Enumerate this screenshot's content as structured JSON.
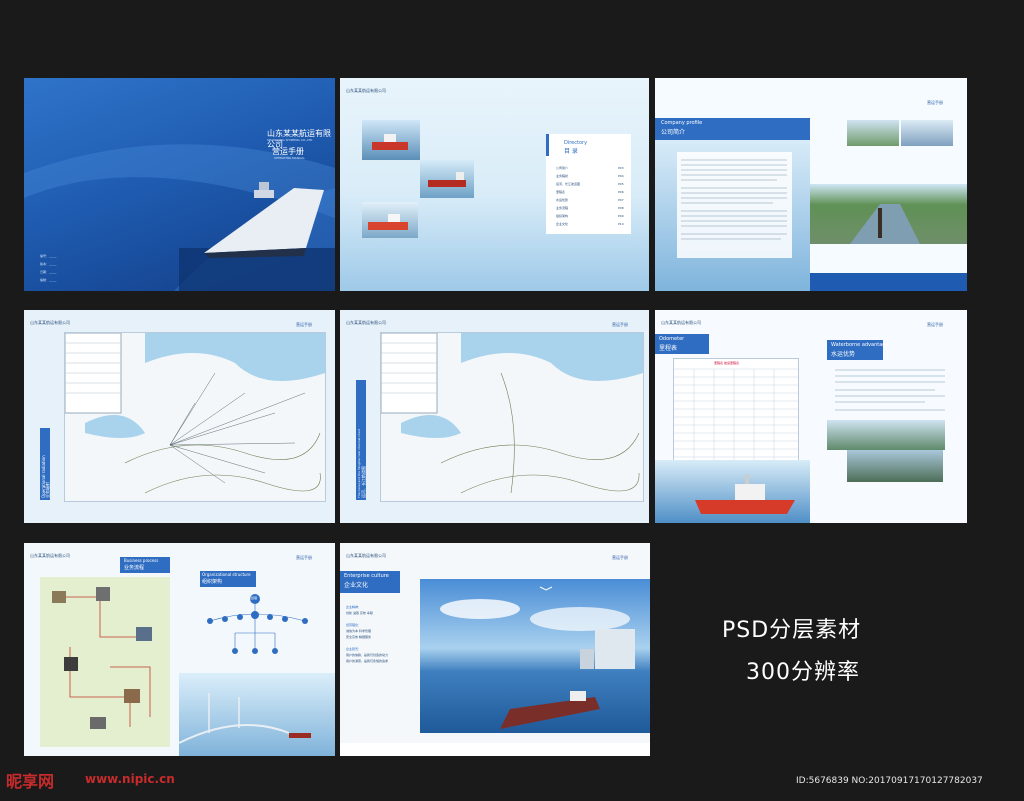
{
  "cover": {
    "company": "山东某某航运有限公司",
    "company_en": "SHANDONG SHIPPING CO.,LTD",
    "manual": "营运手册",
    "manual_en": "OPERATING MANUAL",
    "form_lines": [
      "编号：_____",
      "版本：_____",
      "日期：_____",
      "编制：_____"
    ]
  },
  "company_header": "山东某某航运有限公司",
  "brand": "营运手册",
  "directory": {
    "en": "Directory",
    "cn": "目 录",
    "items": [
      {
        "label": "公司简介",
        "page": "P03"
      },
      {
        "label": "业务辐射",
        "page": "P04"
      },
      {
        "label": "运河、长江航道图",
        "page": "P05"
      },
      {
        "label": "里程表",
        "page": "P06"
      },
      {
        "label": "水运优势",
        "page": "P07"
      },
      {
        "label": "业务流程",
        "page": "P08"
      },
      {
        "label": "组织架构",
        "page": "P09"
      },
      {
        "label": "企业文化",
        "page": "P10"
      }
    ]
  },
  "profile": {
    "en": "Company profile",
    "cn": "公司简介"
  },
  "radiation": {
    "en": "Operational radiation",
    "cn": "业务辐射"
  },
  "channel": {
    "en": "The canal and the Yangtze river channel chart",
    "cn": "运河、长江航道图"
  },
  "odometer": {
    "en": "Odometer",
    "cn": "里程表",
    "table_title": "里程表  航运里程表"
  },
  "waterborne": {
    "en": "Waterborne advantage",
    "cn": "水运优势"
  },
  "process": {
    "en": "Business process",
    "cn": "业务流程"
  },
  "org": {
    "en": "Organizational structure",
    "cn": "组织架构",
    "root": "总经理"
  },
  "culture": {
    "en": "Enterprise culture",
    "cn": "企业文化",
    "lines": [
      "企业精神：",
      "创新  进取  高效  奉献",
      "经营理念：",
      "诚信为本  科学管理",
      "安全高效  精细服务",
      "企业愿景：",
      "用户的信赖，是我们创造的动力",
      "用户的满意，是我们永恒的追求"
    ]
  },
  "promo": {
    "line1": "PSD分层素材",
    "line2": "300分辨率"
  },
  "watermark": {
    "logo": "昵享网",
    "url": "www.nipic.cn",
    "id": "ID:5676839 NO:20170917170127782037"
  },
  "colors": {
    "accent": "#2f6dc2",
    "navy": "#123d86",
    "sky": "#bcdcf2"
  }
}
